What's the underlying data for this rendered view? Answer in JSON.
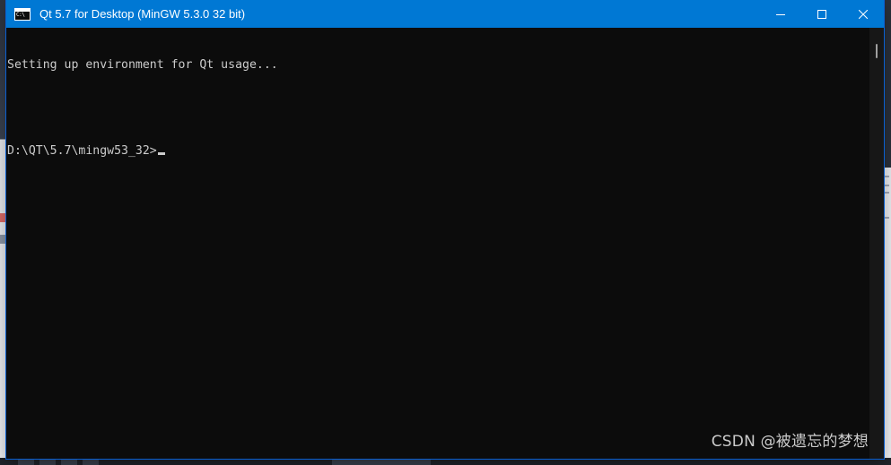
{
  "window": {
    "title": "Qt 5.7 for Desktop (MinGW 5.3.0 32 bit)",
    "icon_text": "C:\\",
    "controls": {
      "minimize": "minimize-icon",
      "maximize": "maximize-icon",
      "close": "close-icon"
    },
    "titlebar_color": "#0078d4",
    "console_bg": "#0c0c0c",
    "console_fg": "#cccccc"
  },
  "console": {
    "lines": [
      "Setting up environment for Qt usage...",
      "",
      "D:\\QT\\5.7\\mingw53_32>"
    ]
  },
  "watermark": "CSDN @被遗忘的梦想"
}
